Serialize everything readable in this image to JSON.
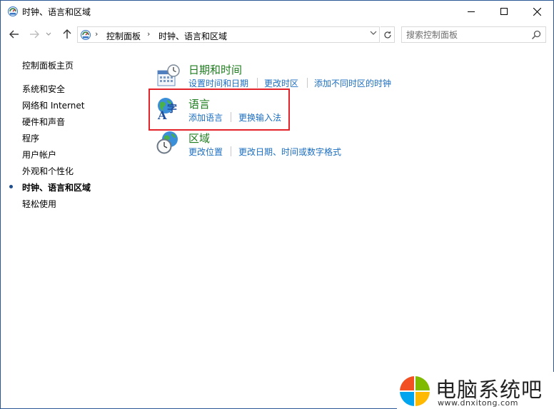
{
  "window": {
    "title": "时钟、语言和区域"
  },
  "address": {
    "crumbs": [
      "控制面板",
      "时钟、语言和区域"
    ]
  },
  "search": {
    "placeholder": "搜索控制面板"
  },
  "sidebar": {
    "items": [
      {
        "label": "控制面板主页"
      },
      {
        "label": "系统和安全"
      },
      {
        "label": "网络和 Internet"
      },
      {
        "label": "硬件和声音"
      },
      {
        "label": "程序"
      },
      {
        "label": "用户帐户"
      },
      {
        "label": "外观和个性化"
      },
      {
        "label": "时钟、语言和区域",
        "current": true
      },
      {
        "label": "轻松使用"
      }
    ]
  },
  "categories": [
    {
      "title": "日期和时间",
      "icon": "calendar-clock-icon",
      "links": [
        "设置时间和日期",
        "更改时区",
        "添加不同时区的时钟"
      ]
    },
    {
      "title": "语言",
      "icon": "language-globe-icon",
      "links": [
        "添加语言",
        "更换输入法"
      ]
    },
    {
      "title": "区域",
      "icon": "region-globe-clock-icon",
      "links": [
        "更改位置",
        "更改日期、时间或数字格式"
      ]
    }
  ],
  "colors": {
    "category_title": "#1e7d1e",
    "link": "#1b6ec2",
    "highlight_box": "#e2232a"
  },
  "watermark": {
    "text": "电脑系统吧",
    "url": "www.dnxitong.com"
  }
}
